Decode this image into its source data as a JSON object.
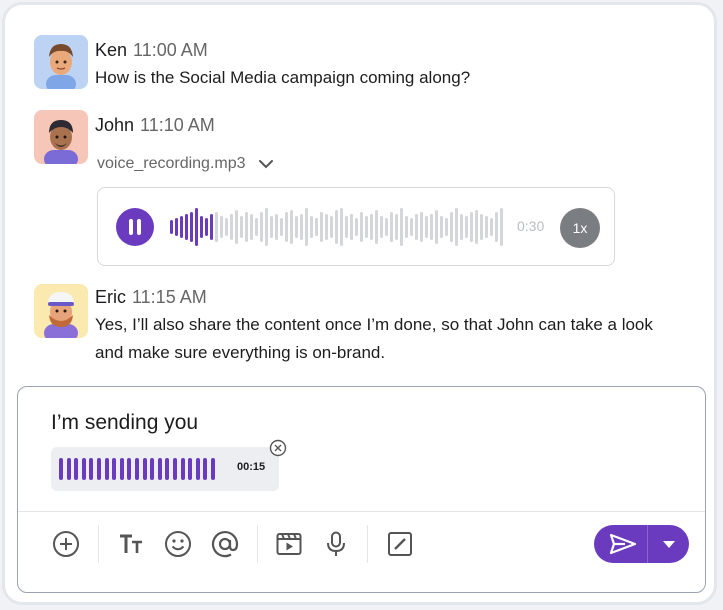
{
  "messages": [
    {
      "author": "Ken",
      "time": "11:00 AM",
      "text": "How is the Social Media campaign coming along?"
    },
    {
      "author": "John",
      "time": "11:10 AM",
      "attachment": {
        "filename": "voice_recording.mp3",
        "duration": "0:30",
        "speed": "1x",
        "state": "playing",
        "progress": 0.12
      }
    },
    {
      "author": "Eric",
      "time": "11:15 AM",
      "text_line1": "Yes, I’ll also share the content once I’m done, so that John can take a look",
      "text_line2": "and make sure everything is on-brand."
    }
  ],
  "composer": {
    "text": "I’m sending you",
    "attachment": {
      "duration": "00:15"
    }
  },
  "toolbar": {
    "icons": [
      "add-circle-icon",
      "text-format-icon",
      "emoji-icon",
      "mention-icon",
      "video-icon",
      "microphone-icon",
      "edit-box-icon"
    ]
  },
  "colors": {
    "accent": "#6a3bbf",
    "wave_inactive": "#d4d6da",
    "speed_badge": "#7a7d82"
  }
}
